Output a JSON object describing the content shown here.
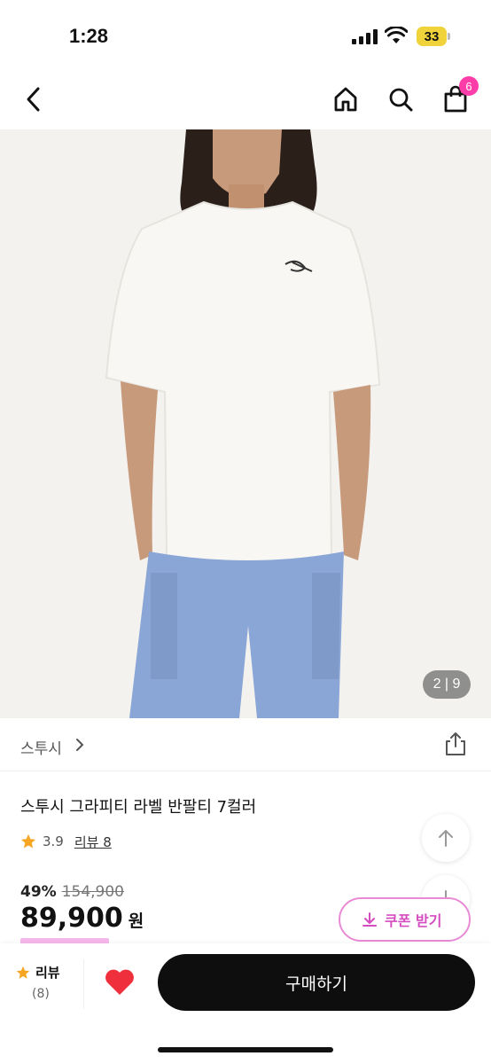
{
  "status_bar": {
    "time": "1:28",
    "battery": "33"
  },
  "nav": {
    "back_icon": "chevron-left-icon",
    "home_icon": "home-icon",
    "search_icon": "search-icon",
    "cart_icon": "shopping-bag-icon",
    "cart_count": "6"
  },
  "gallery": {
    "counter": "2 | 9"
  },
  "brand": {
    "name": "스투시"
  },
  "product": {
    "title": "스투시 그라피티 라벨 반팔티 7컬러",
    "rating": "3.9",
    "review_link": "리뷰 8",
    "discount": "49%",
    "original_price": "154,900",
    "sale_price": "89,900",
    "currency": "원"
  },
  "coupon": {
    "label": "쿠폰 받기"
  },
  "bottom_bar": {
    "review_label": "리뷰",
    "review_count": "(8)",
    "buy_label": "구매하기"
  },
  "colors": {
    "accent": "#ff3da8",
    "coupon": "#d54bc0",
    "star": "#f6a623",
    "heart": "#ef2f3c"
  }
}
